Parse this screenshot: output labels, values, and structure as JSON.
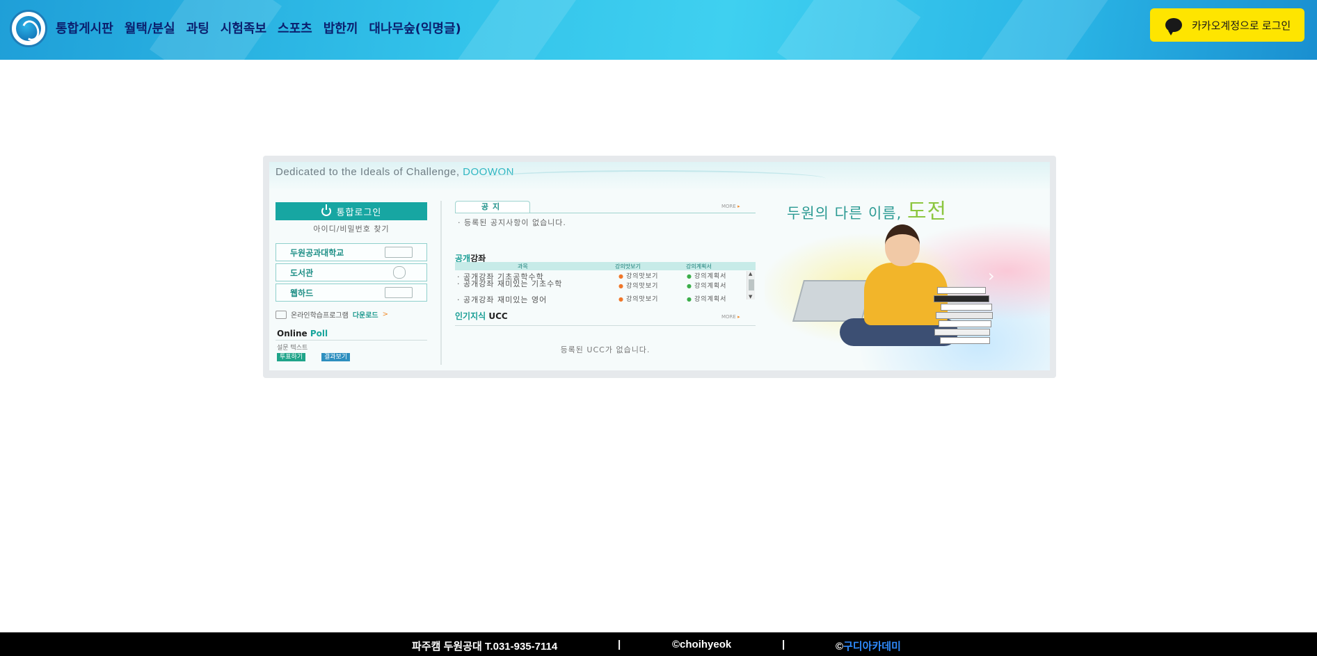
{
  "header": {
    "nav": [
      "통합게시판",
      "월택/분실",
      "과팅",
      "시험족보",
      "스포츠",
      "밥한끼",
      "대나무숲(익명글)"
    ],
    "kakao_login": "카카오계정으로 로그인"
  },
  "portal": {
    "banner_text": "Dedicated to the Ideals of Challenge,",
    "banner_brand": "DOOWON",
    "login_button": "통합로그인",
    "find_account": "아이디/비밀번호 찾기",
    "quick_links": [
      "두원공과대학교",
      "도서관",
      "웹하드"
    ],
    "download_label": "온라인학습프로그램",
    "download_link": "다운로드",
    "download_arrow": ">",
    "poll_title_a": "Online",
    "poll_title_b": "Poll",
    "poll_question": "설문 텍스트",
    "poll_vote": "투표하기",
    "poll_result": "결과보기",
    "notice_tab": "공지",
    "more": "MORE",
    "notice_empty": "· 등록된 공지사항이 없습니다.",
    "lectures_title_a": "공개",
    "lectures_title_b": "강좌",
    "lecture_columns": [
      "과목",
      "강의맛보기",
      "강의계획서"
    ],
    "lectures": [
      {
        "name": "· 공개강좌 기초공학수학",
        "preview": "강의맛보기",
        "plan": "강의계획서"
      },
      {
        "name": "· 공개강좌 재미있는 기초수학",
        "preview": "강의맛보기",
        "plan": "강의계획서"
      },
      {
        "name": "· 공개강좌 재미있는 영어",
        "preview": "강의맛보기",
        "plan": "강의계획서"
      }
    ],
    "ucc_title_a": "인기지식",
    "ucc_title_b": "UCC",
    "ucc_empty": "등록된 UCC가 없습니다.",
    "hero_text": "두원의 다른 이름,",
    "hero_emph": "도전"
  },
  "footer": {
    "campus": "파주캠 두원공대 T.031-935-7114",
    "sep": "|",
    "author": "©choihyeok",
    "copy_symbol": "©",
    "academy": "구디아카데미"
  },
  "colors": {
    "kakao": "#fee500",
    "teal": "#17a6a2",
    "footer_link": "#2f8cff"
  }
}
